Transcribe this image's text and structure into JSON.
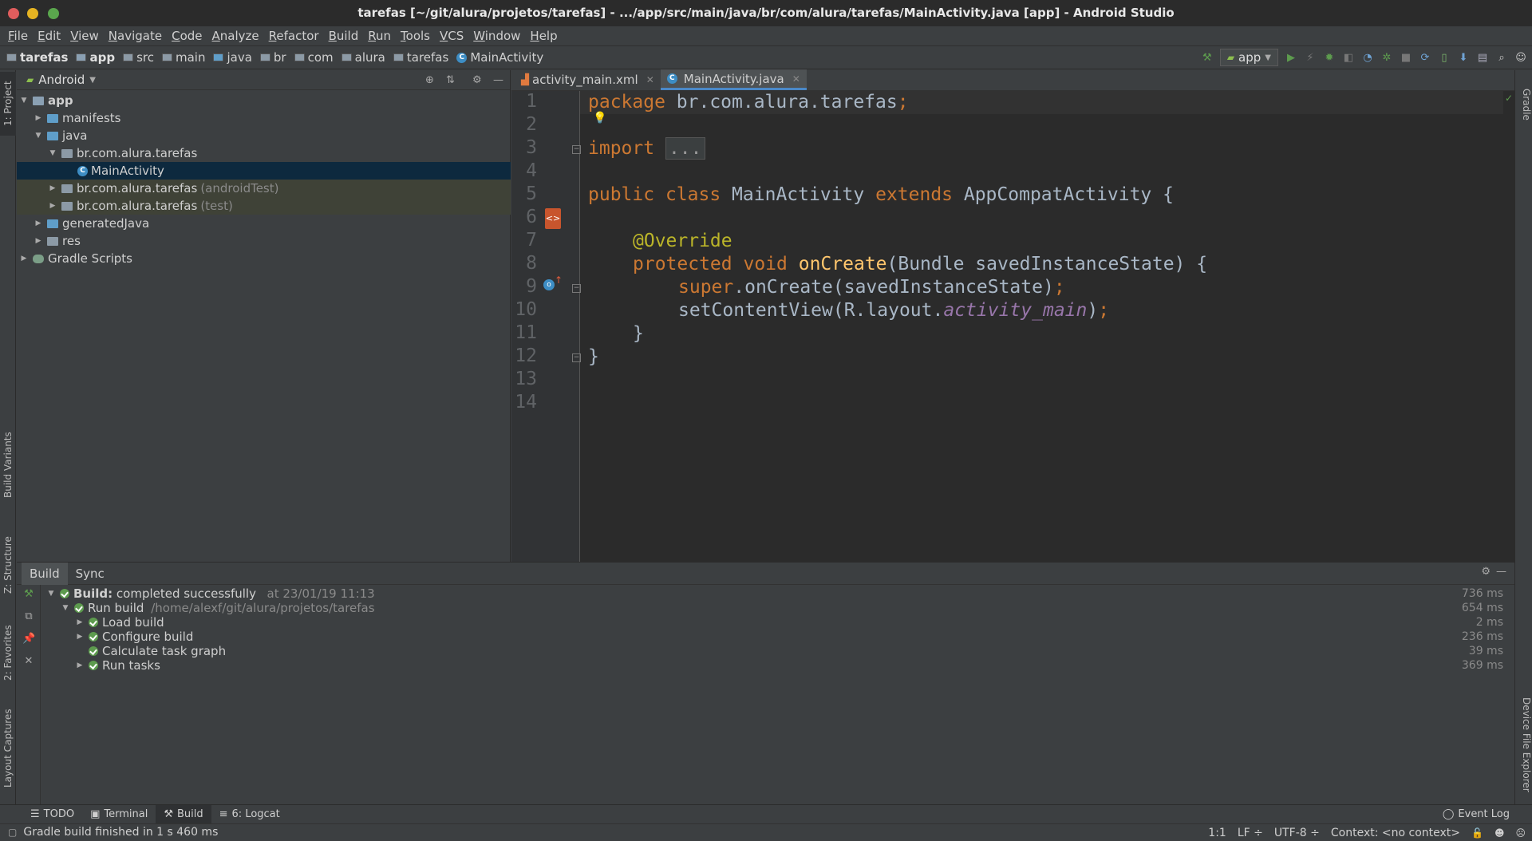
{
  "window": {
    "title": "tarefas [~/git/alura/projetos/tarefas] - .../app/src/main/java/br/com/alura/tarefas/MainActivity.java [app] - Android Studio"
  },
  "menu": [
    "File",
    "Edit",
    "View",
    "Navigate",
    "Code",
    "Analyze",
    "Refactor",
    "Build",
    "Run",
    "Tools",
    "VCS",
    "Window",
    "Help"
  ],
  "breadcrumbs": [
    "tarefas",
    "app",
    "src",
    "main",
    "java",
    "br",
    "com",
    "alura",
    "tarefas",
    "MainActivity"
  ],
  "toolbar": {
    "config": "app"
  },
  "left_tabs": {
    "project": "1: Project",
    "build_variants": "Build Variants",
    "structure": "Z: Structure",
    "favorites": "2: Favorites",
    "layout_captures": "Layout Captures"
  },
  "right_tabs": {
    "gradle": "Gradle",
    "device_file_explorer": "Device File Explorer"
  },
  "project": {
    "view": "Android",
    "tree": [
      {
        "label": "app",
        "suffix": ""
      },
      {
        "label": "manifests",
        "suffix": ""
      },
      {
        "label": "java",
        "suffix": ""
      },
      {
        "label": "br.com.alura.tarefas",
        "suffix": ""
      },
      {
        "label": "MainActivity",
        "suffix": ""
      },
      {
        "label": "br.com.alura.tarefas",
        "suffix": "(androidTest)"
      },
      {
        "label": "br.com.alura.tarefas",
        "suffix": "(test)"
      },
      {
        "label": "generatedJava",
        "suffix": ""
      },
      {
        "label": "res",
        "suffix": ""
      },
      {
        "label": "Gradle Scripts",
        "suffix": ""
      }
    ]
  },
  "editor": {
    "tabs": [
      {
        "label": "activity_main.xml"
      },
      {
        "label": "MainActivity.java"
      }
    ],
    "line_numbers": [
      "1",
      "2",
      "3",
      "4",
      "5",
      "6",
      "7",
      "8",
      "9",
      "10",
      "11",
      "12",
      "13",
      "14"
    ],
    "code": {
      "l1_kw": "package",
      "l1_rest": " br.com.alura.tarefas",
      "l1_semi": ";",
      "l3_kw": "import",
      "l3_fold": "...",
      "l6_kw1": "public",
      "l6_kw2": "class",
      "l6_name": " MainActivity ",
      "l6_kw3": "extends",
      "l6_rest": " AppCompatActivity {",
      "l8": "@Override",
      "l9_kw1": "protected",
      "l9_kw2": "void",
      "l9_fn": "onCreate",
      "l9_rest": "(Bundle savedInstanceState) {",
      "l10_kw": "super",
      "l10_rest": ".onCreate(savedInstanceState)",
      "l10_semi": ";",
      "l11_a": "setContentView(R.layout.",
      "l11_b": "activity_main",
      "l11_c": ")",
      "l11_semi": ";",
      "l12": "}",
      "l13": "}"
    }
  },
  "build": {
    "tabs": [
      "Build",
      "Sync"
    ],
    "rows": [
      {
        "label": "Build:",
        "status": "completed successfully",
        "detail": "at 23/01/19 11:13",
        "time": "736 ms"
      },
      {
        "label": "Run build",
        "detail": "/home/alexf/git/alura/projetos/tarefas",
        "time": "654 ms"
      },
      {
        "label": "Load build",
        "time": "2 ms"
      },
      {
        "label": "Configure build",
        "time": "236 ms"
      },
      {
        "label": "Calculate task graph",
        "time": "39 ms"
      },
      {
        "label": "Run tasks",
        "time": "369 ms"
      }
    ]
  },
  "bottom_tools": [
    "TODO",
    "Terminal",
    "Build",
    "6: Logcat"
  ],
  "event_log": "Event Log",
  "status": {
    "message": "Gradle build finished in 1 s 460 ms",
    "position": "1:1",
    "line_sep": "LF ÷",
    "encoding": "UTF-8 ÷",
    "context": "Context: <no context>"
  },
  "colors": {
    "window_close": "#e05d5d",
    "window_min": "#e6b422",
    "window_max": "#5aa74d",
    "accent": "#4a88c7",
    "selection": "#0d293e",
    "success": "#5d9b4e"
  }
}
